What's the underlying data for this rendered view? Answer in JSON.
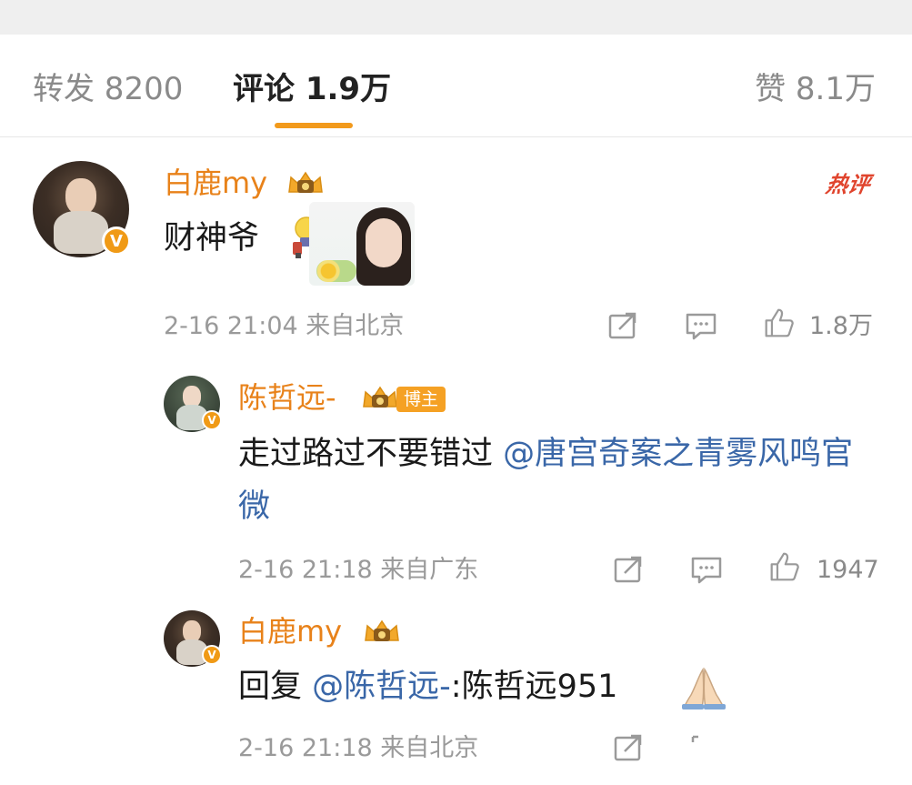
{
  "tabs": {
    "repost": "转发 8200",
    "comments": "评论 1.9万",
    "likes": "赞 8.1万"
  },
  "colors": {
    "accent": "#f29a1c",
    "username": "#e8821a",
    "mention": "#3a67a8",
    "hot_badge": "#e0442d",
    "meta": "#9a9a9a"
  },
  "comments": [
    {
      "username": "白鹿my",
      "badge_hot": "热评",
      "text": "财神爷",
      "emoji": "lightbulb-emoji",
      "sticker": "girl-portrait-sticker",
      "meta": "2-16 21:04 来自北京",
      "likes": "1.8万"
    },
    {
      "username": "陈哲远-",
      "badge_blogger": "博主",
      "text_prefix": "走过路过不要错过 ",
      "mention": "@唐宫奇案之青雾风鸣官微",
      "meta": "2-16 21:18 来自广东",
      "likes": "1947"
    },
    {
      "username": "白鹿my",
      "text_prefix": "回复 ",
      "mention": "@陈哲远-",
      "text_suffix": ":陈哲远951",
      "emoji": "pray-hands-emoji",
      "meta": "2-16 21:18 来自北京"
    }
  ],
  "icons": {
    "verified": "V",
    "share": "share-icon",
    "reply": "comment-icon",
    "like": "thumbs-up-icon",
    "crown": "crown-badge-icon"
  }
}
